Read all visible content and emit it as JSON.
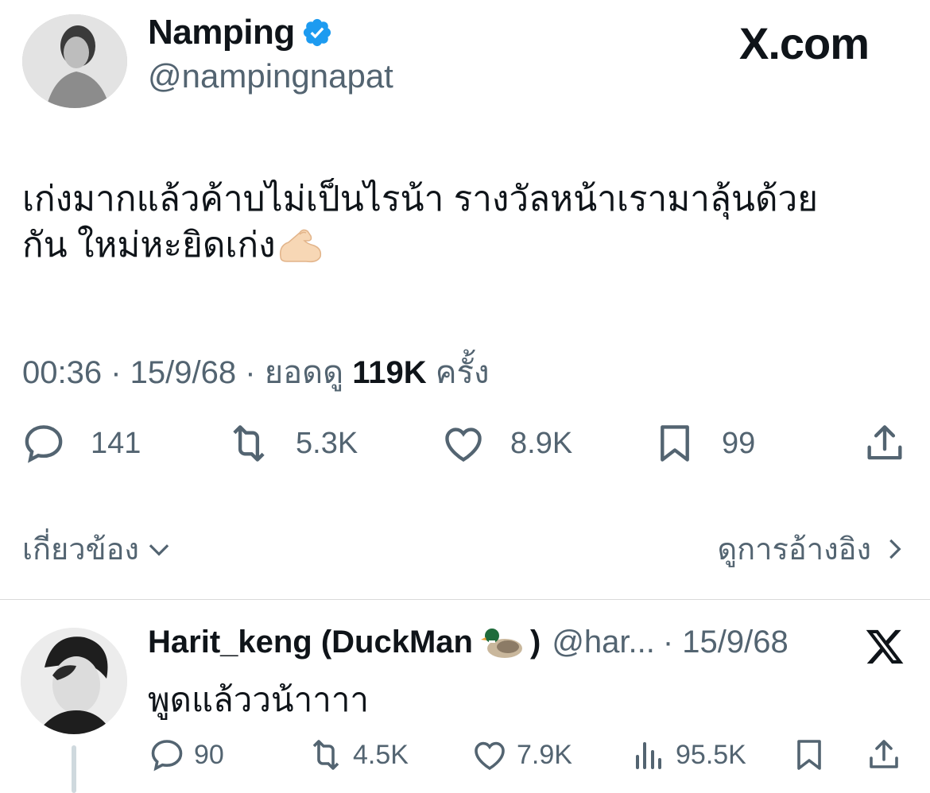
{
  "tweet": {
    "author_name": "Namping",
    "author_handle": "@nampingnapat",
    "site_brand": "X.com",
    "text_line1": "เก่งมากแล้วค้าบไม่เป็นไรน้า รางวัลหน้าเรามาลุ้นด้วย",
    "text_line2": "กัน ใหม่หะยิดเก่ง",
    "time": "00:36",
    "date": "15/9/68",
    "views_prefix": "ยอดดู",
    "views": "119K",
    "views_suffix": "ครั้ง",
    "stats": {
      "replies": "141",
      "reposts": "5.3K",
      "likes": "8.9K",
      "bookmarks": "99"
    },
    "related_label": "เกี่ยวข้อง",
    "quotes_label": "ดูการอ้างอิง"
  },
  "reply": {
    "author_name": "Harit_keng (DuckMan",
    "author_name_close": ")",
    "author_handle": "@har...",
    "date": "· 15/9/68",
    "text": "พูดแล้ววน้าาาา",
    "stats": {
      "replies": "90",
      "reposts": "4.5K",
      "likes": "7.9K",
      "views": "95.5K"
    }
  },
  "icons": [
    "verified-badge-icon",
    "comment-icon",
    "repost-icon",
    "heart-icon",
    "bookmark-icon",
    "share-icon",
    "chevron-down-icon",
    "chevron-right-icon",
    "views-icon",
    "x-logo-icon",
    "duck-emoji-icon",
    "flexed-bicep-emoji-icon"
  ],
  "colors": {
    "verified": "#1d9bf0",
    "text": "#0f1419",
    "secondary": "#536471"
  }
}
